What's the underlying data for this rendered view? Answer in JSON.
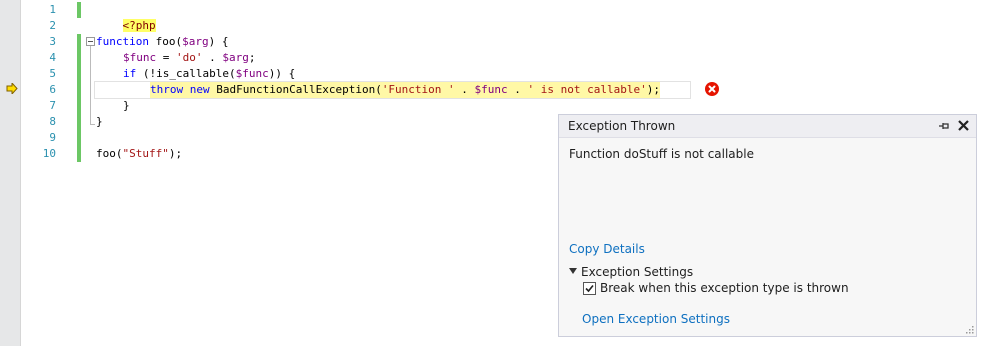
{
  "editor": {
    "line_numbers": [
      "1",
      "2",
      "3",
      "4",
      "5",
      "6",
      "7",
      "8",
      "9",
      "10"
    ],
    "lines": {
      "l1_tag": "<?php",
      "l3_kw": "function",
      "l3_name": " foo(",
      "l3_var": "$arg",
      "l3_end": ") {",
      "l4_var1": "$func",
      "l4_mid": " = ",
      "l4_str": "'do'",
      "l4_dot": " . ",
      "l4_var2": "$arg",
      "l4_end": ";",
      "l5_kw": "if",
      "l5_a": " (!is_callable(",
      "l5_var": "$func",
      "l5_b": ")) {",
      "l6_kw1": "throw",
      "l6_sp": " ",
      "l6_kw2": "new",
      "l6_a": " BadFunctionCallException(",
      "l6_str1": "'Function '",
      "l6_dot1": " . ",
      "l6_var": "$func",
      "l6_dot2": " . ",
      "l6_str2": "' is not callable'",
      "l6_end": ");",
      "l7": "}",
      "l8": "}",
      "l10_a": "foo(",
      "l10_str": "\"Stuff\"",
      "l10_end": ");"
    }
  },
  "exception_popup": {
    "title": "Exception Thrown",
    "message": "Function doStuff is not callable",
    "copy_details": "Copy Details",
    "settings_label": "Exception Settings",
    "checkbox_label": "Break when this exception type is thrown",
    "checkbox_checked": true,
    "open_settings": "Open Exception Settings"
  },
  "colors": {
    "line_number": "#2b91af",
    "keyword": "#0000ff",
    "variable": "#800080",
    "string": "#a31515",
    "change_bar": "#6cc765",
    "current_line_highlight": "#fff8a6",
    "error": "#e51400",
    "link": "#0e70c0"
  },
  "icons": {
    "execution_pointer": "arrow-icon",
    "error": "error-icon",
    "pin": "pin-icon",
    "close": "close-icon",
    "expander": "triangle-down-icon",
    "resize": "resize-grip-icon"
  }
}
